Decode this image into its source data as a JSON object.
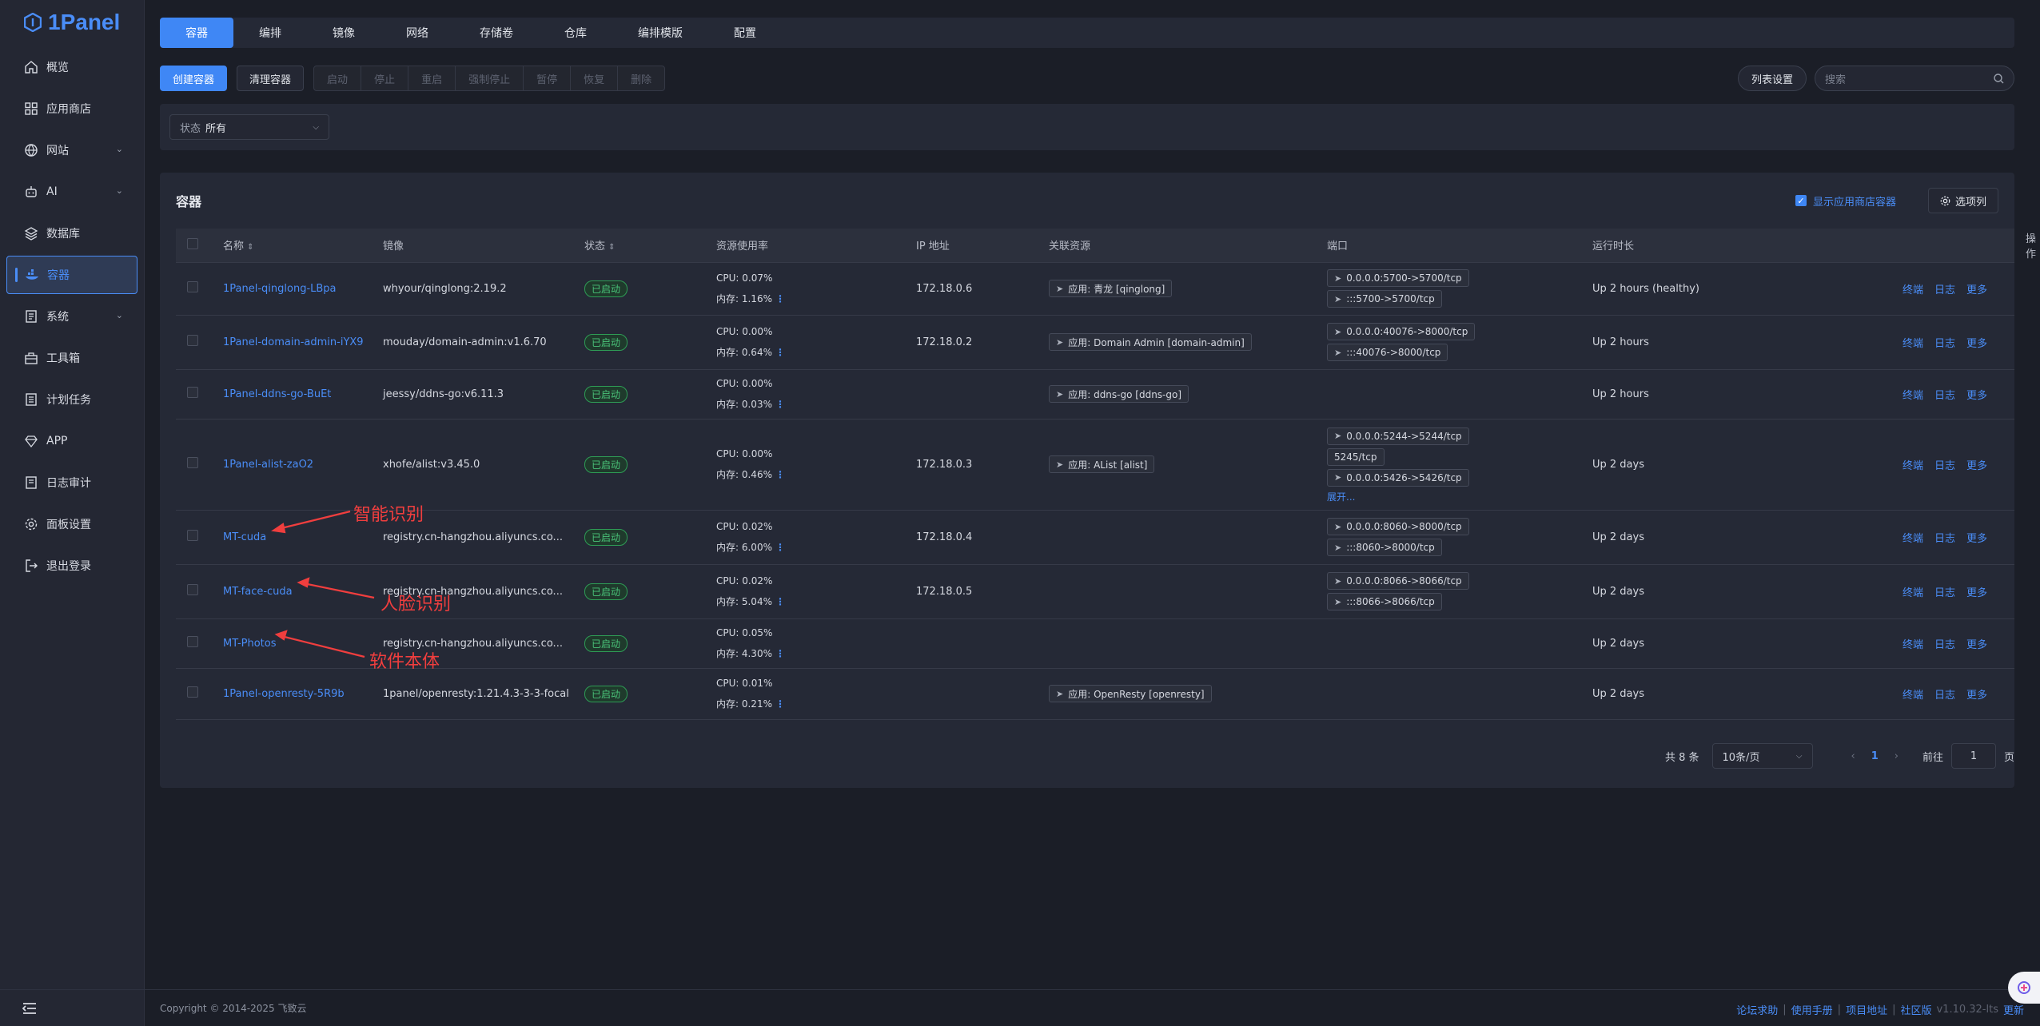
{
  "brand": {
    "name": "1Panel"
  },
  "sidebar": {
    "items": [
      {
        "label": "概览",
        "icon": "home-icon"
      },
      {
        "label": "应用商店",
        "icon": "grid-icon"
      },
      {
        "label": "网站",
        "icon": "globe-icon",
        "expandable": true
      },
      {
        "label": "AI",
        "icon": "robot-icon",
        "expandable": true
      },
      {
        "label": "数据库",
        "icon": "layers-icon"
      },
      {
        "label": "容器",
        "icon": "container-icon",
        "active": true
      },
      {
        "label": "系统",
        "icon": "system-icon",
        "expandable": true
      },
      {
        "label": "工具箱",
        "icon": "toolbox-icon"
      },
      {
        "label": "计划任务",
        "icon": "list-icon"
      },
      {
        "label": "APP",
        "icon": "diamond-icon"
      },
      {
        "label": "日志审计",
        "icon": "log-icon"
      },
      {
        "label": "面板设置",
        "icon": "gear-icon"
      },
      {
        "label": "退出登录",
        "icon": "logout-icon"
      }
    ]
  },
  "tabs": [
    "容器",
    "编排",
    "镜像",
    "网络",
    "存储卷",
    "仓库",
    "编排模版",
    "配置"
  ],
  "toolbar": {
    "create": "创建容器",
    "clean": "清理容器",
    "group": [
      "启动",
      "停止",
      "重启",
      "强制停止",
      "暂停",
      "恢复",
      "删除"
    ],
    "column_settings": "列表设置",
    "search_placeholder": "搜索"
  },
  "filter": {
    "label": "状态",
    "value": "所有"
  },
  "card": {
    "title": "容器",
    "show_app_containers": "显示应用商店容器",
    "options": "选项列"
  },
  "table": {
    "headers": [
      "名称",
      "镜像",
      "状态",
      "资源使用率",
      "IP 地址",
      "关联资源",
      "端口",
      "运行时长",
      "操作"
    ],
    "ops": [
      "终端",
      "日志",
      "更多"
    ],
    "rows": [
      {
        "name": "1Panel-qinglong-LBpa",
        "image": "whyour/qinglong:2.19.2",
        "status": "已启动",
        "cpu": "CPU: 0.07%",
        "mem": "内存: 1.16%",
        "ip": "172.18.0.6",
        "resource": "应用: 青龙 [qinglong]",
        "ports": [
          "0.0.0.0:5700->5700/tcp",
          ":::5700->5700/tcp"
        ],
        "uptime": "Up 2 hours (healthy)"
      },
      {
        "name": "1Panel-domain-admin-iYX9",
        "image": "mouday/domain-admin:v1.6.70",
        "status": "已启动",
        "cpu": "CPU: 0.00%",
        "mem": "内存: 0.64%",
        "ip": "172.18.0.2",
        "resource": "应用: Domain Admin [domain-admin]",
        "ports": [
          "0.0.0.0:40076->8000/tcp",
          ":::40076->8000/tcp"
        ],
        "uptime": "Up 2 hours"
      },
      {
        "name": "1Panel-ddns-go-BuEt",
        "image": "jeessy/ddns-go:v6.11.3",
        "status": "已启动",
        "cpu": "CPU: 0.00%",
        "mem": "内存: 0.03%",
        "ip": "",
        "resource": "应用: ddns-go [ddns-go]",
        "ports": [],
        "uptime": "Up 2 hours"
      },
      {
        "name": "1Panel-alist-zaO2",
        "image": "xhofe/alist:v3.45.0",
        "status": "已启动",
        "cpu": "CPU: 0.00%",
        "mem": "内存: 0.46%",
        "ip": "172.18.0.3",
        "resource": "应用: AList [alist]",
        "ports": [
          "0.0.0.0:5244->5244/tcp",
          "5245/tcp",
          "0.0.0.0:5426->5426/tcp"
        ],
        "expand": "展开...",
        "uptime": "Up 2 days"
      },
      {
        "name": "MT-cuda",
        "image": "registry.cn-hangzhou.aliyuncs.co...",
        "status": "已启动",
        "cpu": "CPU: 0.02%",
        "mem": "内存: 6.00%",
        "ip": "172.18.0.4",
        "resource": "",
        "ports": [
          "0.0.0.0:8060->8000/tcp",
          ":::8060->8000/tcp"
        ],
        "uptime": "Up 2 days"
      },
      {
        "name": "MT-face-cuda",
        "image": "registry.cn-hangzhou.aliyuncs.co...",
        "status": "已启动",
        "cpu": "CPU: 0.02%",
        "mem": "内存: 5.04%",
        "ip": "172.18.0.5",
        "resource": "",
        "ports": [
          "0.0.0.0:8066->8066/tcp",
          ":::8066->8066/tcp"
        ],
        "uptime": "Up 2 days"
      },
      {
        "name": "MT-Photos",
        "image": "registry.cn-hangzhou.aliyuncs.co...",
        "status": "已启动",
        "cpu": "CPU: 0.05%",
        "mem": "内存: 4.30%",
        "ip": "",
        "resource": "",
        "ports": [],
        "uptime": "Up 2 days"
      },
      {
        "name": "1Panel-openresty-5R9b",
        "image": "1panel/openresty:1.21.4.3-3-3-focal",
        "status": "已启动",
        "cpu": "CPU: 0.01%",
        "mem": "内存: 0.21%",
        "ip": "",
        "resource": "应用: OpenResty [openresty]",
        "ports": [],
        "uptime": "Up 2 days"
      }
    ]
  },
  "annotations": [
    "智能识别",
    "人脸识别",
    "软件本体"
  ],
  "pager": {
    "total": "共 8 条",
    "page_size": "10条/页",
    "current": "1",
    "goto_label": "前往",
    "goto_value": "1",
    "page_unit": "页"
  },
  "footer": {
    "copyright": "Copyright © 2014-2025 飞致云",
    "links": [
      "论坛求助",
      "使用手册",
      "项目地址",
      "社区版"
    ],
    "version": "v1.10.32-lts",
    "update": "更新"
  }
}
